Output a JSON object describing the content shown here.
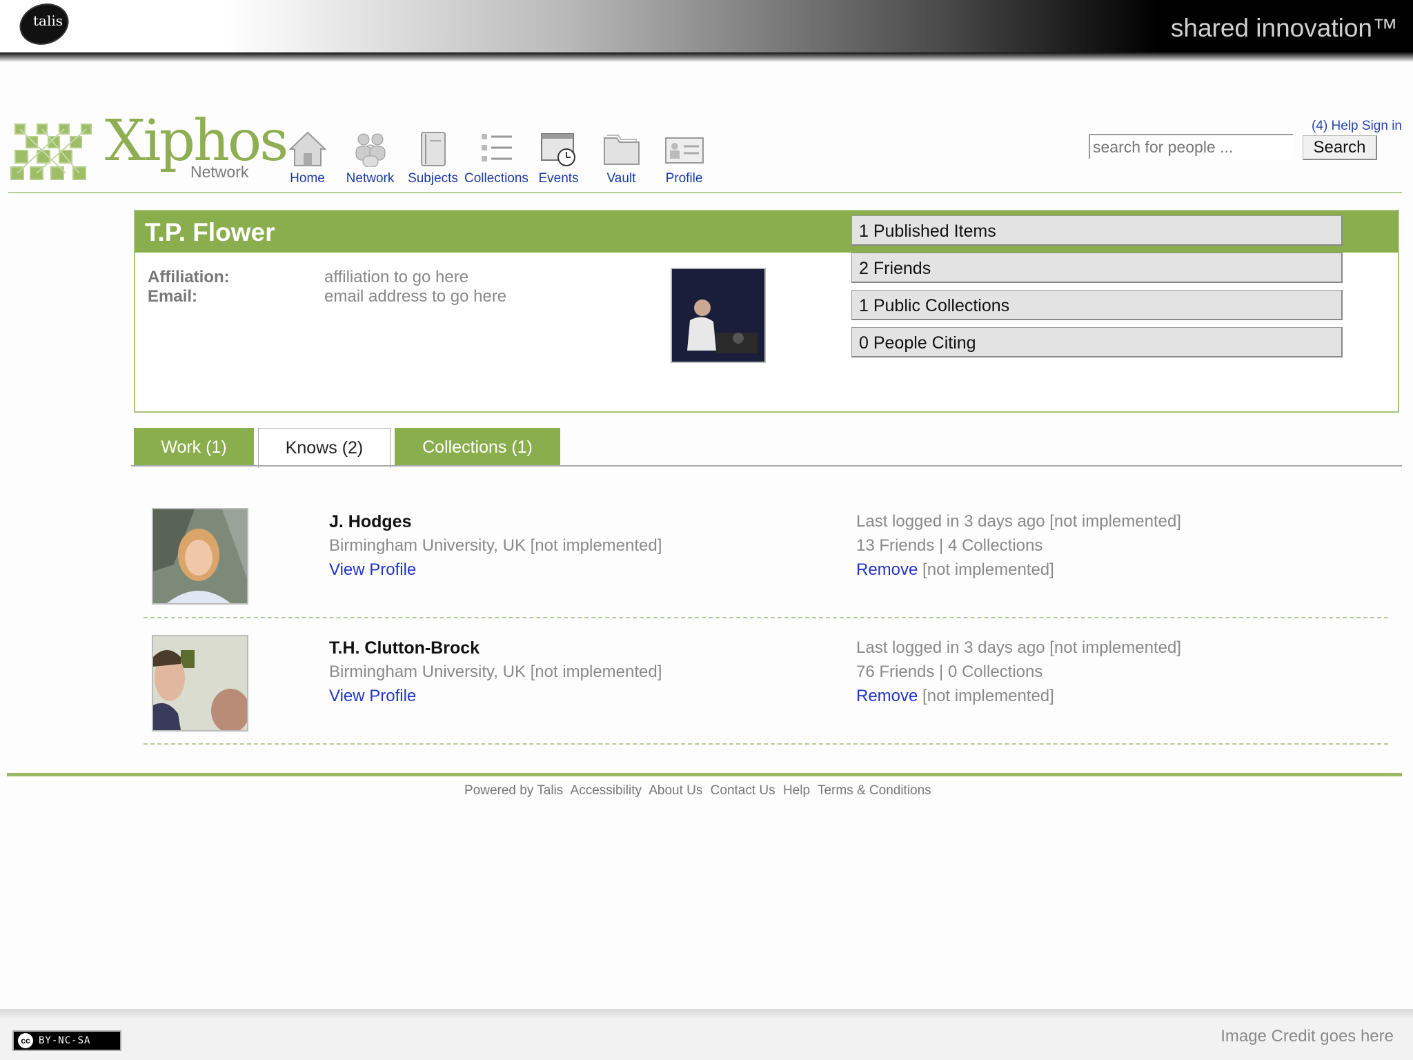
{
  "slide": {
    "brand": "talis",
    "tagline": "shared innovation™",
    "image_credit": "Image Credit goes here",
    "license": "BY-NC-SA",
    "license_cc": "cc"
  },
  "app": {
    "logo_word": "Xiphos",
    "logo_sub": "Network"
  },
  "nav": [
    {
      "label": "Home",
      "icon": "home-icon"
    },
    {
      "label": "Network",
      "icon": "network-icon"
    },
    {
      "label": "Subjects",
      "icon": "subjects-icon"
    },
    {
      "label": "Collections",
      "icon": "collections-icon"
    },
    {
      "label": "Events",
      "icon": "events-icon"
    },
    {
      "label": "Vault",
      "icon": "vault-icon"
    },
    {
      "label": "Profile",
      "icon": "profile-icon"
    }
  ],
  "header": {
    "help_links": "(4) Help Sign in",
    "search_placeholder": "search for people ...",
    "search_button": "Search"
  },
  "profile": {
    "name": "T.P. Flower",
    "affiliation_label": "Affiliation:",
    "affiliation_value": "affiliation to go here",
    "email_label": "Email:",
    "email_value": "email address to go here",
    "stats": [
      "1 Published Items",
      "2 Friends",
      "1 Public Collections",
      "0 People Citing"
    ]
  },
  "tabs": [
    {
      "label": "Work (1)",
      "active": false
    },
    {
      "label": "Knows (2)",
      "active": true
    },
    {
      "label": "Collections (1)",
      "active": false
    }
  ],
  "friends": [
    {
      "name": "J. Hodges",
      "affiliation": "Birmingham University, UK [not implemented]",
      "view_profile": "View Profile",
      "last_logged": "Last logged in 3 days ago [not implemented]",
      "counts": "13 Friends | 4 Collections",
      "remove": "Remove",
      "remove_note": "[not implemented]"
    },
    {
      "name": "T.H. Clutton-Brock",
      "affiliation": "Birmingham University, UK [not implemented]",
      "view_profile": "View Profile",
      "last_logged": "Last logged in 3 days ago [not implemented]",
      "counts": "76 Friends | 0 Collections",
      "remove": "Remove",
      "remove_note": "[not implemented]"
    }
  ],
  "footer": {
    "links": [
      "Powered by Talis",
      "Accessibility",
      "About Us",
      "Contact Us",
      "Help",
      "Terms & Conditions"
    ]
  },
  "colors": {
    "accent_green": "#8aae4e",
    "link_blue": "#2234c9"
  }
}
